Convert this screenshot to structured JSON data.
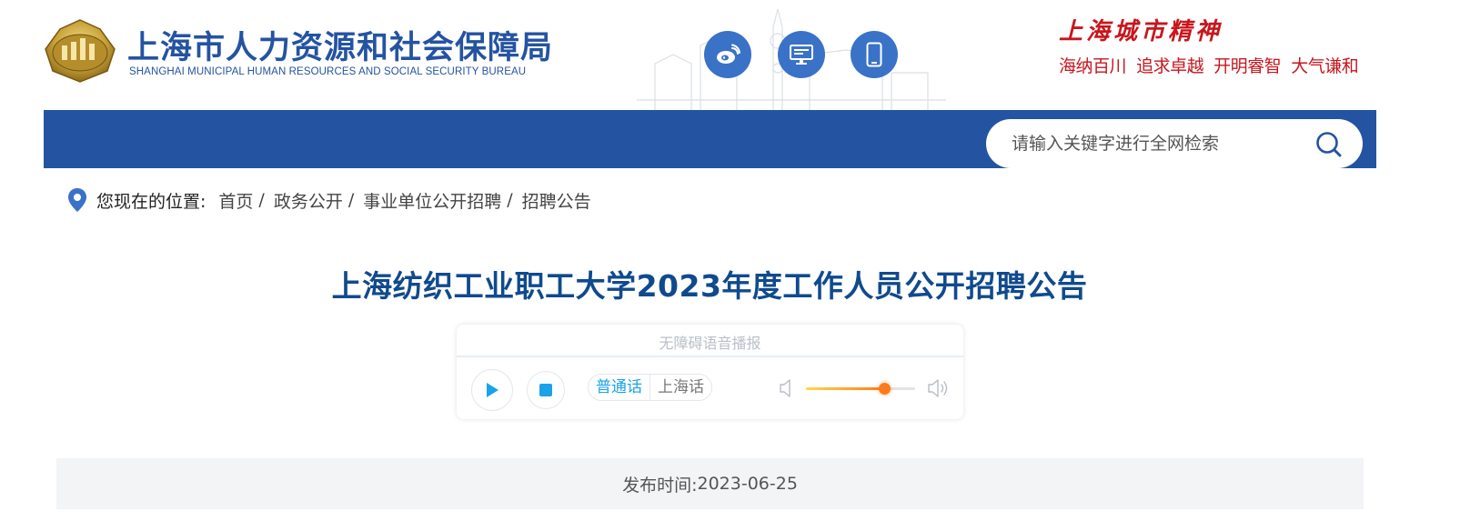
{
  "header": {
    "site_title": "上海市人力资源和社会保障局",
    "site_subtitle": "SHANGHAI MUNICIPAL HUMAN RESOURCES AND SOCIAL SECURITY BUREAU",
    "social_icons": [
      "weibo-icon",
      "desktop-icon",
      "mobile-icon"
    ],
    "spirit_title": "上海城市精神",
    "spirit_motto": "海纳百川  追求卓越  开明睿智  大气谦和"
  },
  "search": {
    "placeholder": "请输入关键字进行全网检索"
  },
  "breadcrumb": {
    "label": "您现在的位置:",
    "items": [
      "首页",
      "政务公开",
      "事业单位公开招聘",
      "招聘公告"
    ],
    "separator": "/"
  },
  "article": {
    "title": "上海纺织工业职工大学2023年度工作人员公开招聘公告",
    "publish_label": "发布时间:",
    "publish_date": "2023-06-25"
  },
  "player": {
    "title": "无障碍语音播报",
    "lang_options": [
      "普通话",
      "上海话"
    ],
    "volume": 0.72
  },
  "colors": {
    "brand_blue": "#2453a2",
    "title_blue": "#104a8e",
    "spirit_red": "#c8161d",
    "accent_cyan": "#1aa3e8",
    "volume_orange": "#ff7a1a"
  }
}
